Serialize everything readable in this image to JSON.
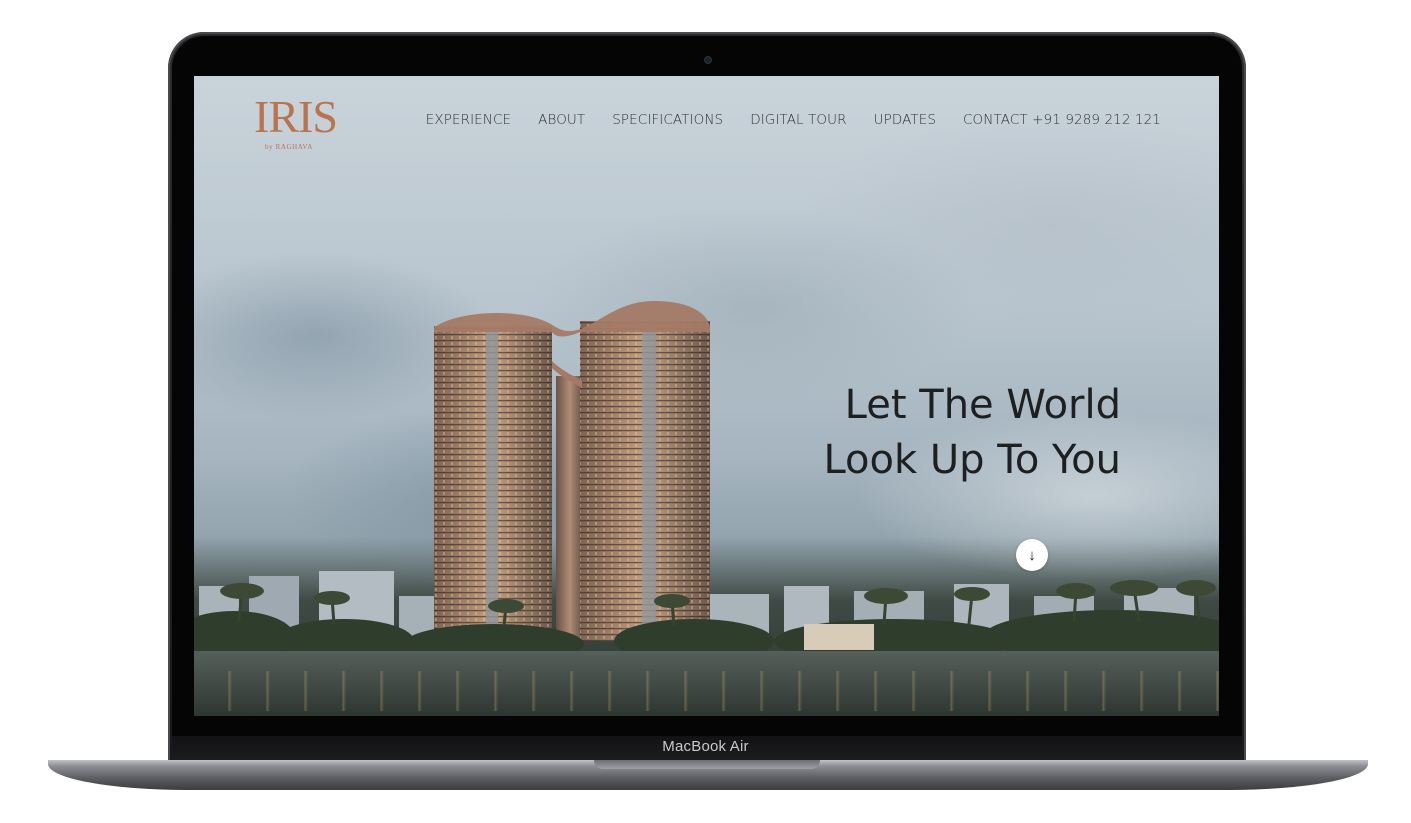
{
  "device": {
    "model_label": "MacBook Air"
  },
  "site": {
    "logo": {
      "mark": "IRIS",
      "sub": "by RAGHAVA",
      "color": "#b9744f"
    },
    "nav": [
      {
        "label": "EXPERIENCE"
      },
      {
        "label": "ABOUT"
      },
      {
        "label": "SPECIFICATIONS"
      },
      {
        "label": "DIGITAL TOUR"
      },
      {
        "label": "UPDATES"
      },
      {
        "label": "CONTACT +91 9289 212 121"
      }
    ],
    "hero": {
      "line1": "Let The World",
      "line2": "Look Up To You"
    },
    "scroll_icon": "arrow-down-icon",
    "scroll_glyph": "↓"
  }
}
